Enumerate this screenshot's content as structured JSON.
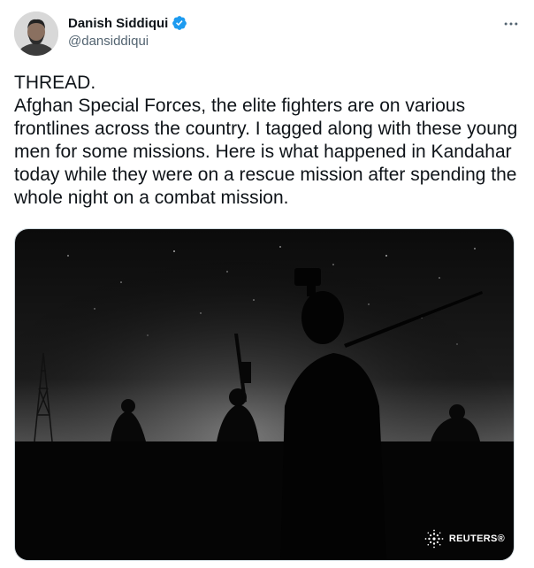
{
  "author": {
    "display_name": "Danish Siddiqui",
    "handle": "@dansiddiqui",
    "verified": true
  },
  "tweet": {
    "text": "THREAD.\nAfghan Special Forces, the elite fighters are on various frontlines across the country. I tagged along with these young men for some missions. Here is what happened in Kandahar today while they were on a rescue mission after spending the whole night on a combat mission."
  },
  "media": {
    "credit": "REUTERS®"
  },
  "icons": {
    "verified": "verified-badge-icon",
    "more": "more-options-icon",
    "credit_logo": "reuters-logo-icon"
  },
  "colors": {
    "verified_blue": "#1d9bf0",
    "text_primary": "#0f1419",
    "text_secondary": "#536471"
  }
}
